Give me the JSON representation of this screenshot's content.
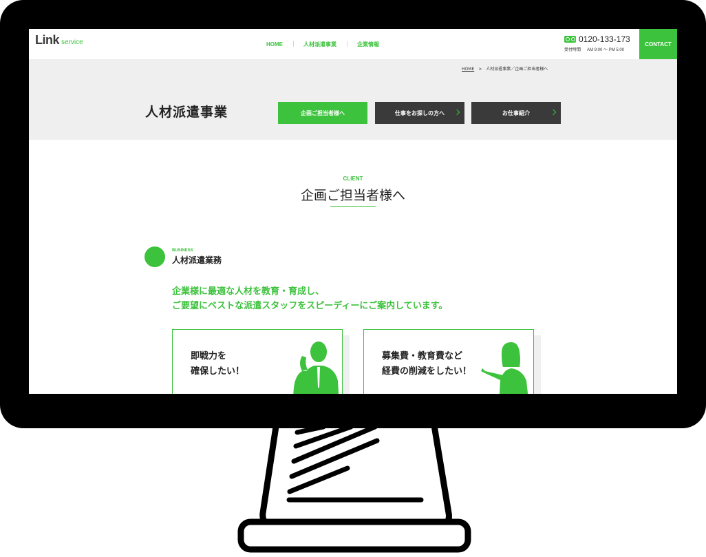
{
  "header": {
    "logo_main": "Link",
    "logo_sub": "service",
    "nav": [
      {
        "label": "HOME"
      },
      {
        "label": "人材派遣事業"
      },
      {
        "label": "企業情報"
      }
    ],
    "phone": "0120-133-173",
    "hours_label": "受付時間",
    "hours": "AM 9:00 〜 PM 5:00",
    "contact_label": "CONTACT"
  },
  "breadcrumb": {
    "home": "HOME",
    "separator": ">",
    "current": "人材派遣事業／企画ご担当者様へ"
  },
  "hero": {
    "title": "人材派遣事業",
    "tabs": [
      {
        "label": "企画ご担当者様へ"
      },
      {
        "label": "仕事をお探しの方へ"
      },
      {
        "label": "お仕事紹介"
      }
    ]
  },
  "section": {
    "en": "CLIENT",
    "title": "企画ご担当者様へ"
  },
  "business": {
    "en": "BUSINESS",
    "title": "人材派遣業務",
    "lead_line1": "企業様に最適な人材を教育・育成し、",
    "lead_line2": "ご要望にベストな派遣スタッフをスピーディーにご案内しています。"
  },
  "cards": [
    {
      "line1": "即戦力を",
      "line2": "確保したい！"
    },
    {
      "line1": "募集費・教育費など",
      "line2": "経費の削減をしたい！"
    }
  ],
  "colors": {
    "accent": "#3cc23c",
    "dark": "#3a3a3a",
    "bezel": "#000000"
  }
}
